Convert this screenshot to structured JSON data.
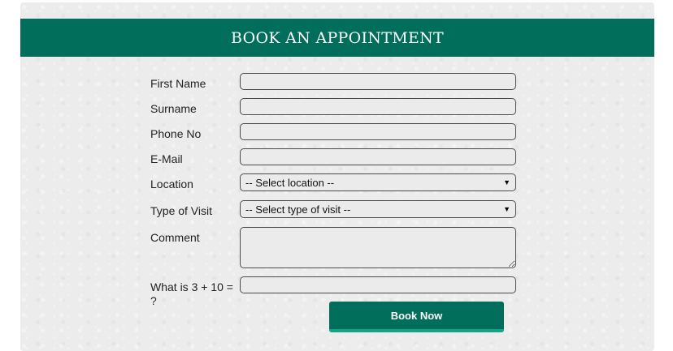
{
  "header": {
    "title": "BOOK AN APPOINTMENT"
  },
  "form": {
    "first_name_label": "First Name",
    "surname_label": "Surname",
    "phone_label": "Phone No",
    "email_label": "E-Mail",
    "location_label": "Location",
    "location_selected": "-- Select location --",
    "visit_type_label": "Type of Visit",
    "visit_type_selected": "-- Select type of visit --",
    "comment_label": "Comment",
    "captcha_label": "What is 3 + 10 = ?",
    "submit_label": "Book Now"
  },
  "icons": {
    "location_dropdown": "chevron-down-icon",
    "visit_dropdown": "chevron-down-icon"
  },
  "colors": {
    "brand_green": "#006e5a",
    "button_accent": "#14a384",
    "panel_background": "#ececec"
  }
}
